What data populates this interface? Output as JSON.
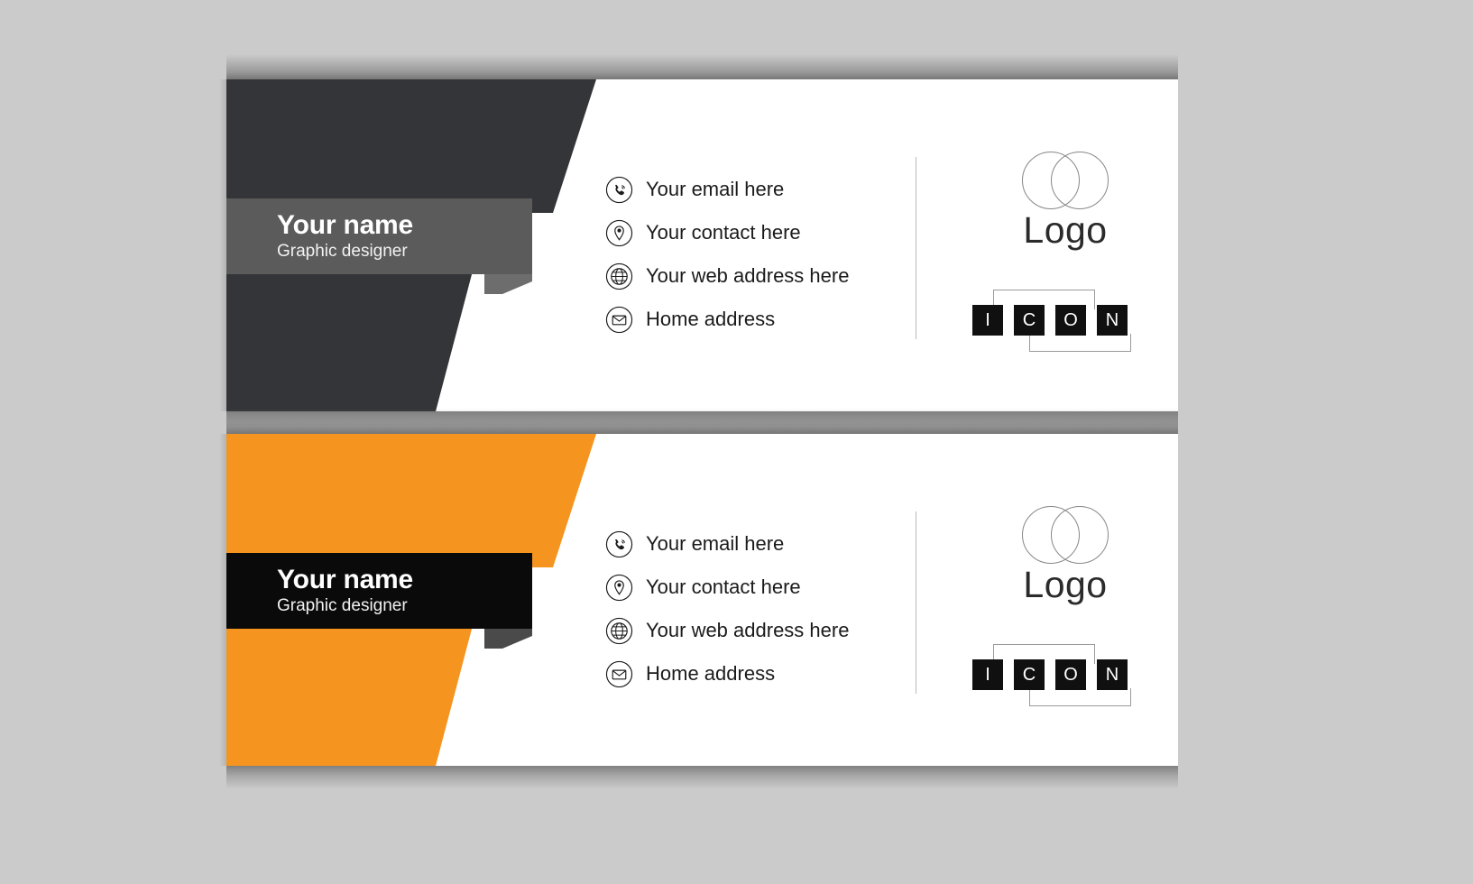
{
  "page": {
    "background_color": "#cbcbcb",
    "card_background": "#ffffff"
  },
  "colors": {
    "dark_panel": "#343538",
    "dark_band": "#5b5b5b",
    "orange_panel": "#f5941f",
    "black_band": "#0a0a0a",
    "icon_square": "#101010",
    "divider": "#b9b9b9",
    "logo_outline": "#888888"
  },
  "cards": [
    {
      "variant": "dark",
      "panel_color": "#343538",
      "band_color": "#5b5b5b",
      "name": "Your name",
      "role": "Graphic designer",
      "contacts": [
        {
          "icon": "phone-icon",
          "label": "Your email here"
        },
        {
          "icon": "location-pin-icon",
          "label": "Your contact here"
        },
        {
          "icon": "globe-icon",
          "label": "Your web address here"
        },
        {
          "icon": "envelope-icon",
          "label": "Home address"
        }
      ],
      "logo": {
        "word": "Logo",
        "mark": "two-overlapping-circles-icon"
      },
      "icon_badge": {
        "letters": [
          "I",
          "C",
          "O",
          "N"
        ]
      }
    },
    {
      "variant": "light",
      "panel_color": "#f5941f",
      "band_color": "#0a0a0a",
      "name": "Your name",
      "role": "Graphic designer",
      "contacts": [
        {
          "icon": "phone-icon",
          "label": "Your email here"
        },
        {
          "icon": "location-pin-icon",
          "label": "Your contact here"
        },
        {
          "icon": "globe-icon",
          "label": "Your web address here"
        },
        {
          "icon": "envelope-icon",
          "label": "Home address"
        }
      ],
      "logo": {
        "word": "Logo",
        "mark": "two-overlapping-circles-icon"
      },
      "icon_badge": {
        "letters": [
          "I",
          "C",
          "O",
          "N"
        ]
      }
    }
  ]
}
